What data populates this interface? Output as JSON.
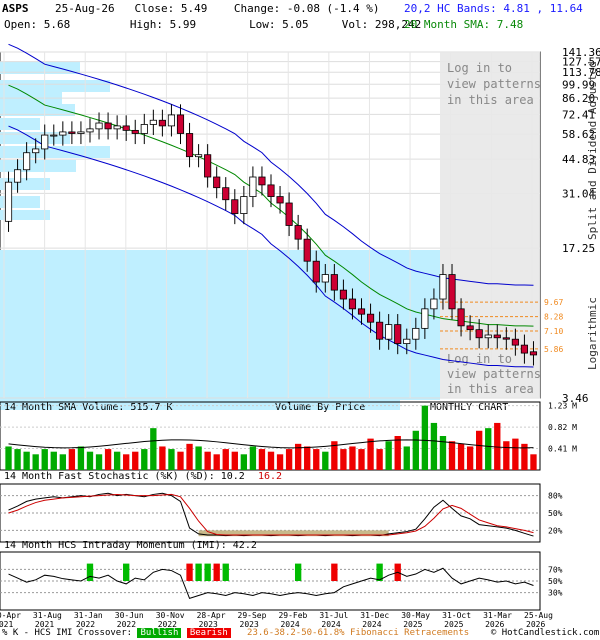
{
  "header": {
    "symbol": "ASPS",
    "date": "25-Aug-26",
    "close": "Close: 5.49",
    "change": "Change: -0.08 (-1.4 %)",
    "open": "Open: 5.68",
    "high": "High: 5.99",
    "low": "Low: 5.05",
    "vol": "Vol: 298,242",
    "bands": "20,2 HC Bands: 4.81 , 11.64",
    "sma": "20 Month SMA: 7.48"
  },
  "price_panel": {
    "y_ticks": [
      "141.36",
      "127.57",
      "113.78",
      "99.99",
      "86.20",
      "72.41",
      "58.62",
      "44.83",
      "31.04",
      "17.25",
      "3.46"
    ],
    "fib_labels": [
      "9.67",
      "8.28",
      "7.10",
      "5.86"
    ],
    "axis_label": "Split and Dividend Adjusted",
    "scale_label": "Logarithmic",
    "login_text": [
      "Log in to",
      "view patterns",
      "in this area"
    ],
    "volume_sma": "14 Month SMA Volume: 515.7 K",
    "volume_by_price": "Volume By Price",
    "chart_type": "MONTHLY CHART"
  },
  "volume_panel": {
    "y_ticks": [
      "1.23 M",
      "0.82 M",
      "0.41 M"
    ]
  },
  "stoch_panel": {
    "title": "14 Month Fast Stochastic (%K) (%D): 10.2",
    "d_value": "16.2",
    "y_ticks": [
      "80%",
      "50%",
      "20%"
    ]
  },
  "imi_panel": {
    "title": "14 Month HCS Intraday Momentum (IMI): 42.2",
    "y_ticks": [
      "70%",
      "50%",
      "30%"
    ]
  },
  "x_ticks": [
    [
      "30-Apr",
      "2021"
    ],
    [
      "31-Aug",
      "2021"
    ],
    [
      "31-Jan",
      "2022"
    ],
    [
      "30-Jun",
      "2022"
    ],
    [
      "30-Nov",
      "2022"
    ],
    [
      "28-Apr",
      "2023"
    ],
    [
      "29-Sep",
      "2023"
    ],
    [
      "29-Feb",
      "2024"
    ],
    [
      "31-Jul",
      "2024"
    ],
    [
      "31-Dec",
      "2024"
    ],
    [
      "30-May",
      "2025"
    ],
    [
      "31-Oct",
      "2025"
    ],
    [
      "31-Mar",
      "2026"
    ],
    [
      "25-Aug",
      "2026"
    ]
  ],
  "footer": {
    "prefix": "% K - HCS IMI Crossover:",
    "bullish": "Bullish",
    "bearish": "Bearish",
    "fib": "23.6-38.2-50-61.8% Fibonacci Retracements",
    "copyright": "© HotCandlestick.com"
  },
  "colors": {
    "up": "#ffffff",
    "down": "#cc0033",
    "vol_up": "#00aa00",
    "vol_down": "#ee0000",
    "sma": "#008800",
    "bands": "#0000cc",
    "vbp": "#bfefff"
  },
  "chart_data": {
    "type": "candlestick",
    "title": "ASPS",
    "scale": "log",
    "ylim": [
      3.46,
      141.36
    ],
    "series": [
      {
        "name": "price",
        "open": [
          23,
          35,
          40,
          48,
          50,
          58,
          58,
          60,
          59,
          60,
          62,
          66,
          62,
          64,
          61,
          59,
          65,
          68,
          64,
          72,
          59,
          46,
          47,
          37,
          33,
          29,
          25,
          30,
          37,
          34,
          30,
          28,
          22,
          19,
          15,
          12,
          13,
          11,
          10,
          9,
          8.5,
          7.8,
          6.5,
          7.6,
          6.2,
          6.5,
          7.3,
          9,
          10,
          13,
          9,
          7.5,
          7.2,
          6.6,
          6.8,
          6.6,
          6.5,
          6.1,
          5.68
        ],
        "close": [
          35,
          40,
          48,
          50,
          58,
          58,
          60,
          59,
          60,
          62,
          66,
          62,
          64,
          61,
          59,
          65,
          68,
          64,
          72,
          59,
          46,
          47,
          37,
          33,
          29,
          25,
          30,
          37,
          34,
          30,
          28,
          22,
          19,
          15,
          12,
          13,
          11,
          10,
          9,
          8.5,
          7.8,
          6.5,
          7.6,
          6.2,
          6.5,
          7.3,
          9,
          10,
          13,
          9,
          7.5,
          7.2,
          6.6,
          6.8,
          6.6,
          6.5,
          6.1,
          5.6,
          5.49
        ]
      },
      {
        "name": "20 Month SMA",
        "values": [
          99,
          95,
          90,
          85,
          80,
          78,
          76,
          74,
          72,
          70,
          68,
          66,
          64,
          62,
          60,
          58,
          56,
          54,
          52,
          50,
          48,
          46,
          44,
          42,
          40,
          38,
          35,
          33,
          31,
          28,
          26,
          24,
          22,
          20,
          18,
          16,
          15,
          14,
          13,
          12,
          11.2,
          10.5,
          10,
          9.5,
          9,
          8.7,
          8.5,
          8.3,
          8.1,
          8,
          7.9,
          7.8,
          7.7,
          7.6,
          7.6,
          7.55,
          7.5,
          7.5,
          7.48
        ]
      }
    ],
    "volume": [
      0.45,
      0.4,
      0.35,
      0.3,
      0.4,
      0.35,
      0.3,
      0.4,
      0.45,
      0.35,
      0.3,
      0.4,
      0.35,
      0.3,
      0.35,
      0.4,
      0.8,
      0.45,
      0.4,
      0.35,
      0.5,
      0.45,
      0.35,
      0.3,
      0.4,
      0.35,
      0.3,
      0.45,
      0.4,
      0.35,
      0.3,
      0.4,
      0.5,
      0.45,
      0.4,
      0.35,
      0.55,
      0.4,
      0.45,
      0.4,
      0.6,
      0.4,
      0.55,
      0.65,
      0.45,
      0.75,
      1.23,
      0.9,
      0.65,
      0.55,
      0.5,
      0.45,
      0.75,
      0.8,
      0.9,
      0.55,
      0.6,
      0.5,
      0.3
    ],
    "stoch_k": [
      55,
      62,
      70,
      74,
      76,
      78,
      76,
      78,
      80,
      78,
      82,
      84,
      80,
      82,
      80,
      78,
      82,
      84,
      80,
      70,
      24,
      14,
      12,
      12,
      11,
      12,
      11,
      12,
      12,
      11,
      12,
      12,
      11,
      12,
      12,
      11,
      12,
      12,
      11,
      12,
      12,
      11,
      14,
      16,
      18,
      22,
      40,
      60,
      72,
      58,
      45,
      40,
      30,
      28,
      26,
      24,
      20,
      15,
      10.2
    ],
    "stoch_d": [
      50,
      55,
      62,
      68,
      72,
      74,
      76,
      77,
      78,
      79,
      80,
      81,
      82,
      81,
      80,
      80,
      80,
      81,
      82,
      78,
      58,
      36,
      18,
      13,
      12,
      12,
      12,
      12,
      12,
      12,
      12,
      12,
      12,
      12,
      12,
      12,
      12,
      12,
      12,
      12,
      12,
      12,
      12,
      14,
      16,
      19,
      27,
      41,
      57,
      63,
      58,
      48,
      38,
      33,
      28,
      26,
      23,
      20,
      16.2
    ],
    "imi": [
      62,
      55,
      48,
      52,
      60,
      58,
      54,
      52,
      50,
      58,
      55,
      60,
      50,
      45,
      55,
      52,
      65,
      70,
      68,
      60,
      20,
      25,
      30,
      28,
      25,
      30,
      28,
      25,
      30,
      28,
      25,
      28,
      30,
      28,
      25,
      28,
      30,
      40,
      45,
      50,
      55,
      52,
      60,
      65,
      58,
      62,
      70,
      65,
      72,
      55,
      45,
      50,
      55,
      52,
      48,
      50,
      45,
      48,
      42.2
    ],
    "crossovers": [
      {
        "i": 9,
        "type": "bullish"
      },
      {
        "i": 13,
        "type": "bullish"
      },
      {
        "i": 20,
        "type": "bearish"
      },
      {
        "i": 21,
        "type": "bullish"
      },
      {
        "i": 22,
        "type": "bullish"
      },
      {
        "i": 23,
        "type": "bearish"
      },
      {
        "i": 24,
        "type": "bullish"
      },
      {
        "i": 32,
        "type": "bullish"
      },
      {
        "i": 36,
        "type": "bearish"
      },
      {
        "i": 41,
        "type": "bullish"
      },
      {
        "i": 43,
        "type": "bearish"
      }
    ],
    "fib_levels": [
      9.67,
      8.28,
      7.1,
      5.86
    ]
  }
}
